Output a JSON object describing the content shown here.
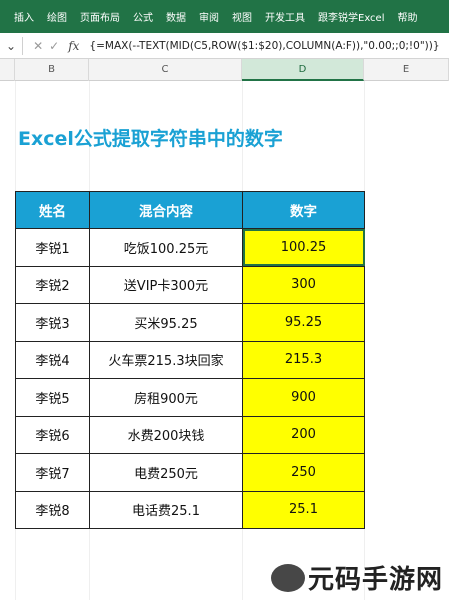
{
  "ribbon": {
    "tabs": [
      "插入",
      "绘图",
      "页面布局",
      "公式",
      "数据",
      "审阅",
      "视图",
      "开发工具",
      "跟李锐学Excel",
      "帮助"
    ]
  },
  "formula_bar": {
    "formula": "{=MAX(--TEXT(MID(C5,ROW($1:$20),COLUMN(A:F)),\"0.00;;0;!0\"))}"
  },
  "column_headers": [
    "B",
    "C",
    "D",
    "E"
  ],
  "sheet": {
    "title": "Excel公式提取字符串中的数字",
    "headers": [
      "姓名",
      "混合内容",
      "数字"
    ],
    "rows": [
      {
        "name": "李锐1",
        "content": "吃饭100.25元",
        "number": "100.25"
      },
      {
        "name": "李锐2",
        "content": "送VIP卡300元",
        "number": "300"
      },
      {
        "name": "李锐3",
        "content": "买米95.25",
        "number": "95.25"
      },
      {
        "name": "李锐4",
        "content": "火车票215.3块回家",
        "number": "215.3"
      },
      {
        "name": "李锐5",
        "content": "房租900元",
        "number": "900"
      },
      {
        "name": "李锐6",
        "content": "水费200块钱",
        "number": "200"
      },
      {
        "name": "李锐7",
        "content": "电费250元",
        "number": "250"
      },
      {
        "name": "李锐8",
        "content": "电话费25.1",
        "number": "25.1"
      }
    ]
  },
  "colors": {
    "ribbon": "#217346",
    "title": "#1aa1d4",
    "header_fill": "#1aa1d4",
    "number_fill": "#ffff00"
  },
  "watermark": {
    "text": "元码手游网"
  }
}
